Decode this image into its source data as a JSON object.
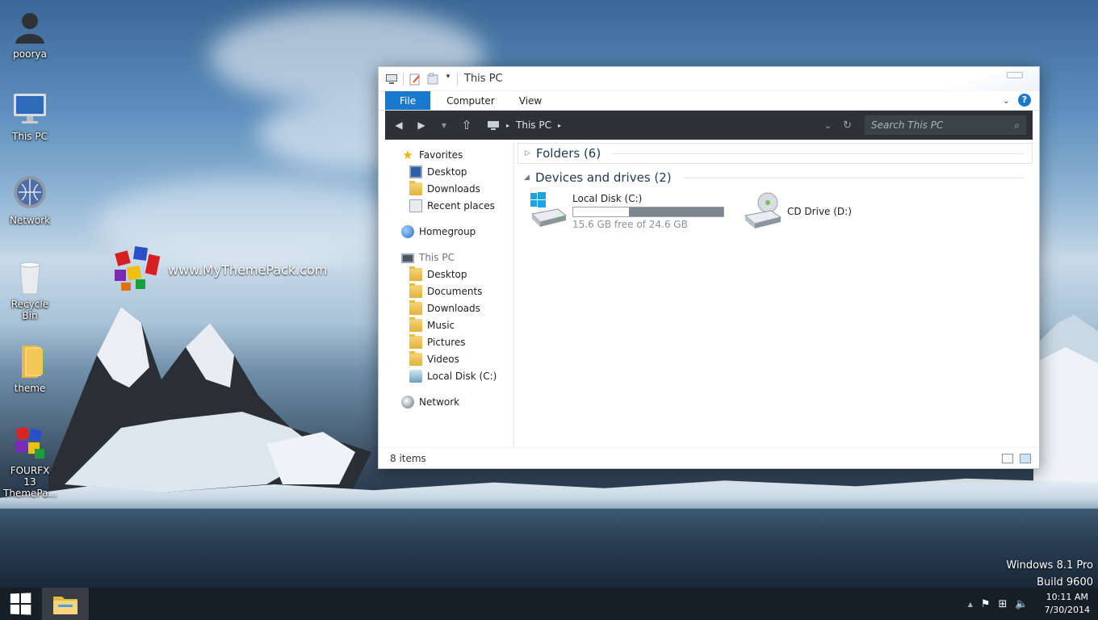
{
  "desktop": {
    "icons": [
      {
        "label": "poorya"
      },
      {
        "label": "This PC"
      },
      {
        "label": "Network"
      },
      {
        "label": "Recycle Bin"
      },
      {
        "label": "theme"
      },
      {
        "label": "FOURFX 13 ThemePa..."
      }
    ],
    "brand_text": "www.MyThemePack.com",
    "watermark": {
      "line1": "Windows 8.1 Pro",
      "line2": "Build 9600"
    }
  },
  "explorer": {
    "title": "This PC",
    "ribbon": {
      "file": "File",
      "computer": "Computer",
      "view": "View",
      "help": "?"
    },
    "address": {
      "crumb": "This PC"
    },
    "search": {
      "placeholder": "Search This PC"
    },
    "nav": {
      "favorites": "Favorites",
      "fav_items": [
        "Desktop",
        "Downloads",
        "Recent places"
      ],
      "homegroup": "Homegroup",
      "this_pc": "This PC",
      "pc_items": [
        "Desktop",
        "Documents",
        "Downloads",
        "Music",
        "Pictures",
        "Videos",
        "Local Disk (C:)"
      ],
      "network": "Network"
    },
    "groups": {
      "folders": "Folders (6)",
      "devices": "Devices and drives (2)"
    },
    "drives": [
      {
        "name": "Local Disk (C:)",
        "free_text": "15.6 GB free of 24.6 GB",
        "used_fraction": 0.37
      },
      {
        "name": "CD Drive (D:)"
      }
    ],
    "status": {
      "items": "8 items"
    }
  },
  "taskbar": {
    "time": "10:11 AM",
    "date": "7/30/2014"
  },
  "colors": {
    "accent": "#1979ca",
    "navbar": "#2b3338"
  }
}
